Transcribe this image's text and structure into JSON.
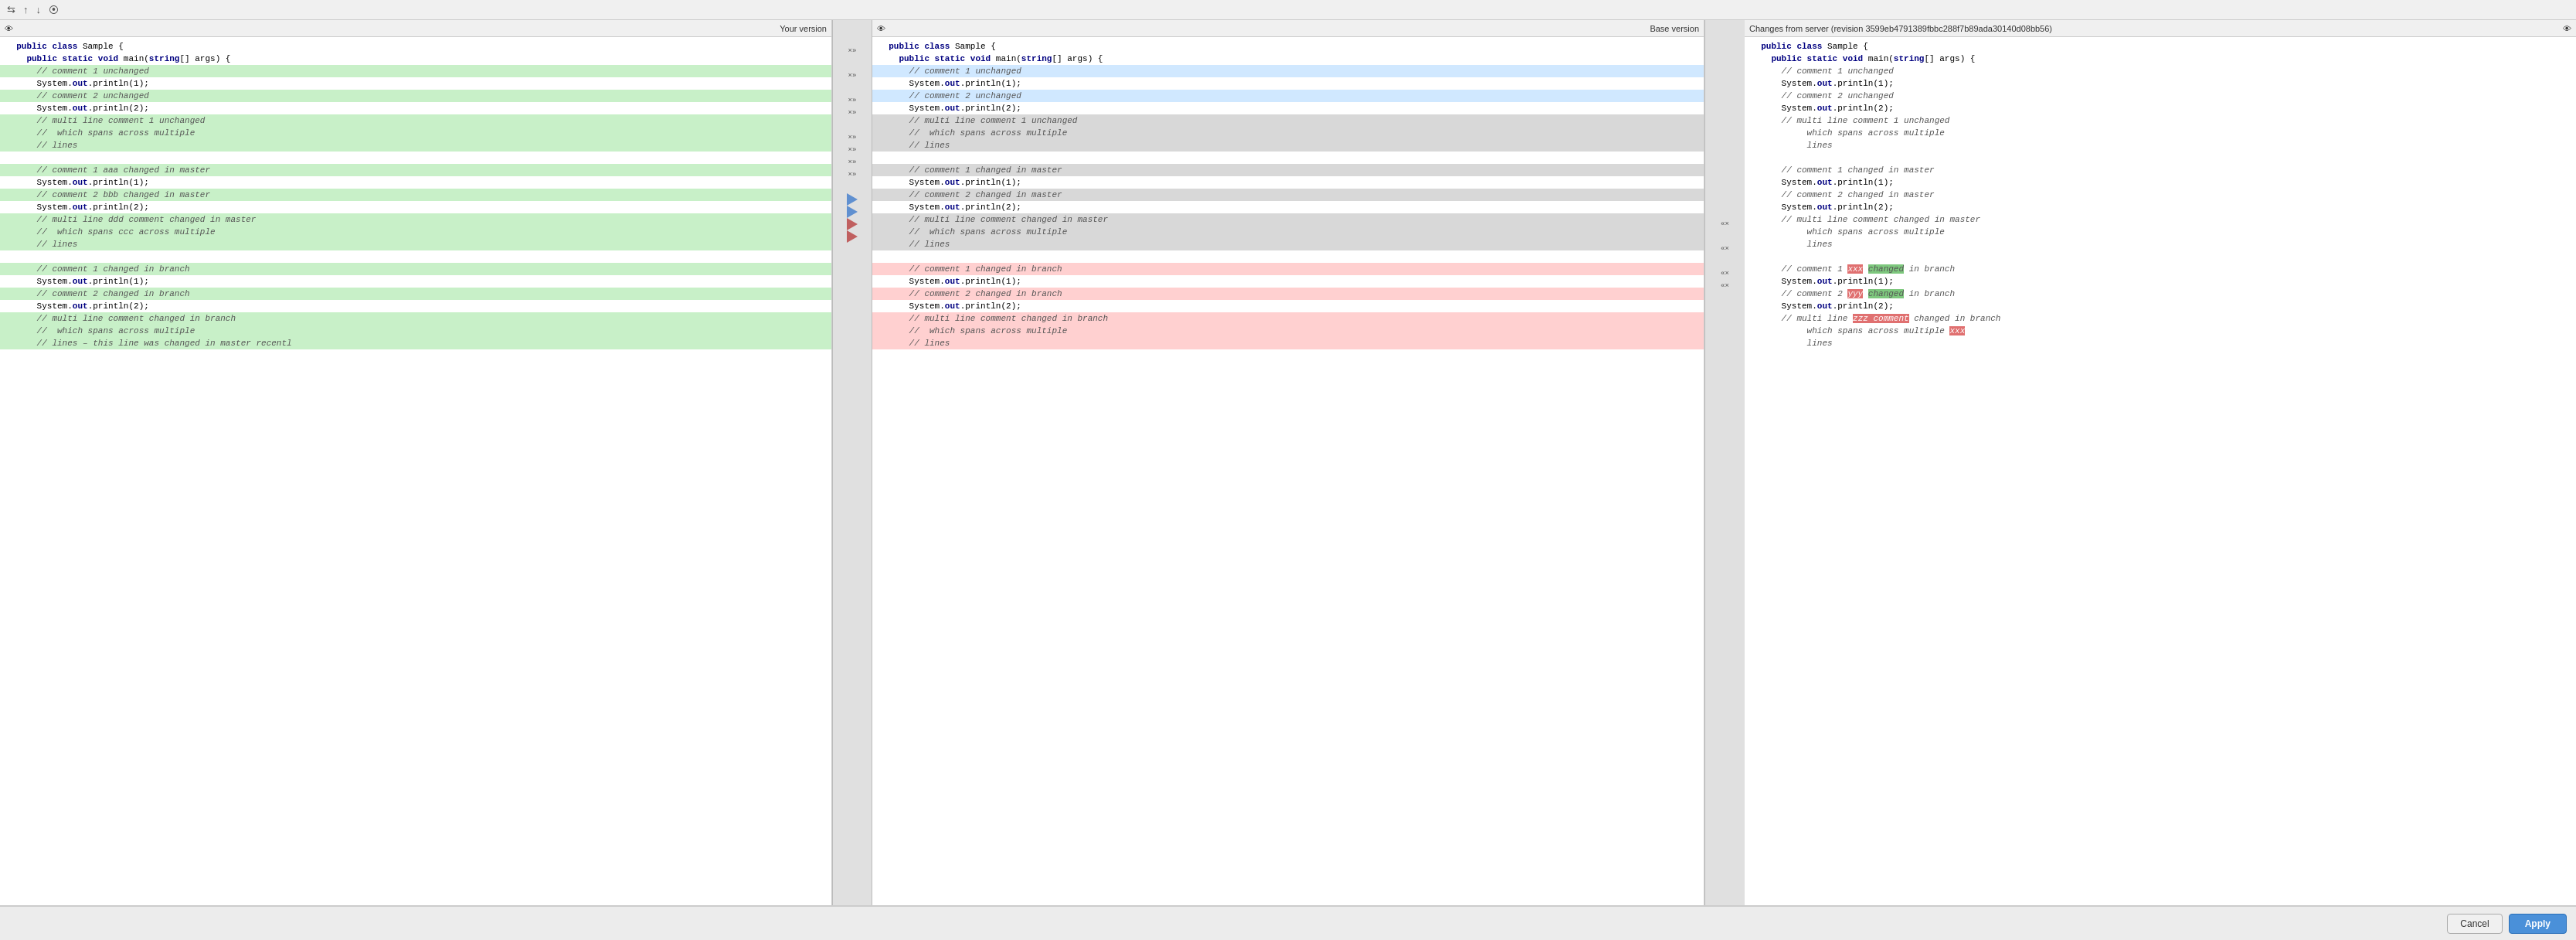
{
  "toolbar": {
    "icons": [
      "⇆",
      "↑",
      "↓",
      "⦿"
    ]
  },
  "panels": {
    "left": {
      "title": "Your version",
      "eye_icon": "👁"
    },
    "middle": {
      "title": "Base version",
      "eye_icon": "👁"
    },
    "right": {
      "title": "Changes from server (revision 3599eb4791389fbbc288f7b89ada30140d08bb56)",
      "eye_icon": "👁"
    }
  },
  "footer": {
    "cancel_label": "Cancel",
    "apply_label": "Apply"
  }
}
